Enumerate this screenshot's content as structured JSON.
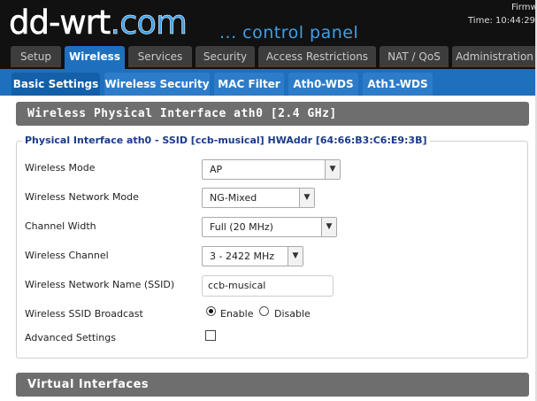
{
  "header": {
    "logo_main": "dd-wrt",
    "logo_sep": ".",
    "logo_com": "com",
    "tagline": "... control panel",
    "firmware": "Firmw",
    "time": "Time: 10:44:29"
  },
  "main_tabs": [
    {
      "label": "Setup"
    },
    {
      "label": "Wireless"
    },
    {
      "label": "Services"
    },
    {
      "label": "Security"
    },
    {
      "label": "Access Restrictions"
    },
    {
      "label": "NAT / QoS"
    },
    {
      "label": "Administration"
    }
  ],
  "sub_tabs": [
    {
      "label": "Basic Settings"
    },
    {
      "label": "Wireless Security"
    },
    {
      "label": "MAC Filter"
    },
    {
      "label": "Ath0-WDS"
    },
    {
      "label": "Ath1-WDS"
    }
  ],
  "section_title": "Wireless Physical Interface ath0 [2.4 GHz]",
  "fieldset_legend": "Physical Interface ath0 - SSID [ccb-musical] HWAddr [64:66:B3:C6:E9:3B]",
  "fields": {
    "wireless_mode": {
      "label": "Wireless Mode",
      "value": "AP"
    },
    "network_mode": {
      "label": "Wireless Network Mode",
      "value": "NG-Mixed"
    },
    "channel_width": {
      "label": "Channel Width",
      "value": "Full (20 MHz)"
    },
    "channel": {
      "label": "Wireless Channel",
      "value": "3 - 2422 MHz"
    },
    "ssid": {
      "label": "Wireless Network Name (SSID)",
      "value": "ccb-musical"
    },
    "ssid_broadcast": {
      "label": "Wireless SSID Broadcast",
      "enable": "Enable",
      "disable": "Disable",
      "selected": "Enable"
    },
    "advanced": {
      "label": "Advanced Settings",
      "checked": false
    }
  },
  "virtual_section_title": "Virtual Interfaces",
  "colors": {
    "accent": "#1f6fbf",
    "logo_blue": "#3ea0e6",
    "section_gray": "#6e6e6e",
    "legend_blue": "#1a3a8a"
  }
}
